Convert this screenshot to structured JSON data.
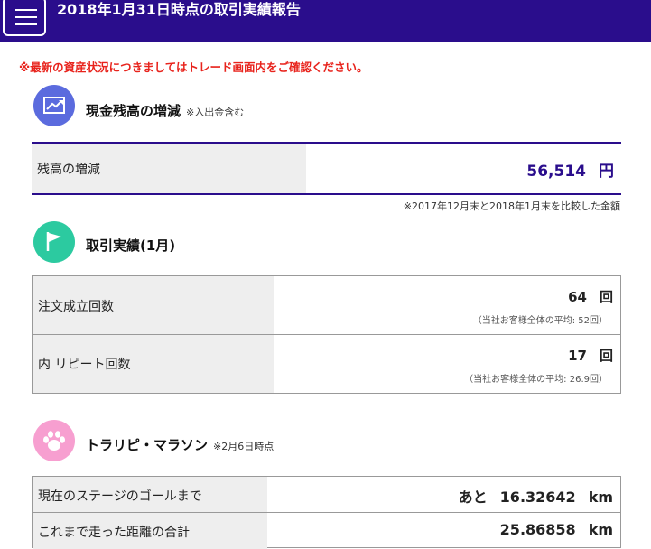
{
  "header": {
    "title": "2018年1月31日時点の取引実績報告",
    "logo_icon": "document-list-icon",
    "bg_color": "#2a0d8c"
  },
  "notice": "※最新の資産状況につきましてはトレード画面内をご確認ください。",
  "cash_section": {
    "icon": "trend-chart-icon",
    "icon_color": "#5b6bde",
    "title": "現金残高の増減",
    "title_note": "※入出金含む",
    "row_label": "残高の増減",
    "value": "56,514",
    "unit": "円",
    "footnote": "※2017年12月末と2018年1月末を比較した金額"
  },
  "trades_section": {
    "icon": "flag-icon",
    "icon_color": "#2ccaa0",
    "title": "取引実績(1月)",
    "rows": [
      {
        "label": "注文成立回数",
        "value": "64",
        "unit": "回",
        "sub": "（当社お客様全体の平均: 52回）"
      },
      {
        "label": "内 リピート回数",
        "value": "17",
        "unit": "回",
        "sub": "（当社お客様全体の平均: 26.9回）"
      }
    ]
  },
  "marathon_section": {
    "icon": "paw-icon",
    "icon_color": "#f79fd0",
    "title": "トラリピ・マラソン",
    "title_note": "※2月6日時点",
    "rows": [
      {
        "label": "現在のステージのゴールまで",
        "prefix": "あと",
        "value": "16.32642",
        "unit": "km"
      },
      {
        "label": "これまで走った距離の合計",
        "prefix": "",
        "value": "25.86858",
        "unit": "km"
      }
    ]
  }
}
